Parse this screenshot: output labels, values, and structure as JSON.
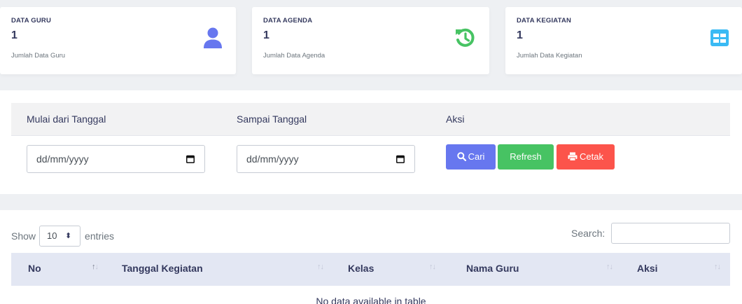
{
  "cards": [
    {
      "title": "DATA GURU",
      "count": "1",
      "subtitle": "Jumlah Data Guru",
      "icon": "user-icon",
      "color": "#6777ef"
    },
    {
      "title": "DATA AGENDA",
      "count": "1",
      "subtitle": "Jumlah Data Agenda",
      "icon": "history-icon",
      "color": "#47c363"
    },
    {
      "title": "DATA KEGIATAN",
      "count": "1",
      "subtitle": "Jumlah Data Kegiatan",
      "icon": "table-icon",
      "color": "#3abaf4"
    }
  ],
  "filter": {
    "headers": [
      "Mulai dari Tanggal",
      "Sampai Tanggal",
      "Aksi"
    ],
    "date_from_placeholder": "dd/mm/yyyy",
    "date_to_placeholder": "dd/mm/yyyy",
    "buttons": {
      "search": "Cari",
      "refresh": "Refresh",
      "print": "Cetak"
    }
  },
  "datatable": {
    "show_label": "Show",
    "entries_value": "10",
    "entries_label": "entries",
    "search_label": "Search:",
    "columns": [
      "No",
      "Tanggal Kegiatan",
      "Kelas",
      "Nama Guru",
      "Aksi"
    ],
    "empty_message": "No data available in table"
  },
  "colors": {
    "primary": "#6777ef",
    "success": "#47c363",
    "danger": "#fc544b",
    "info": "#3abaf4"
  }
}
